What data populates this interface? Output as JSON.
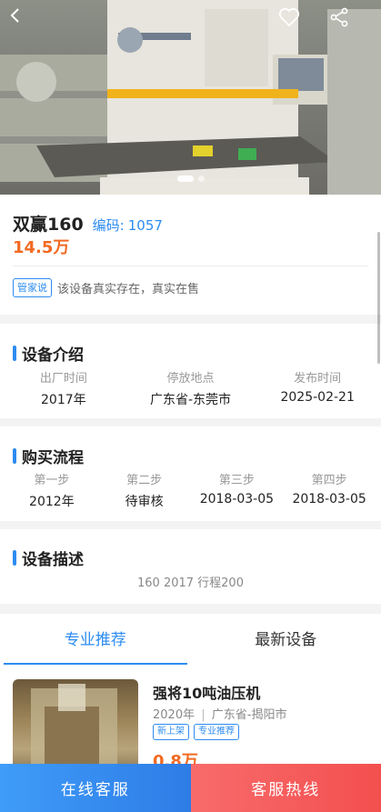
{
  "hero": {
    "back_icon": "back-arrow-icon",
    "favorite_icon": "heart-outline-icon",
    "share_icon": "share-icon",
    "slide_count": 2,
    "active_slide": 1
  },
  "product": {
    "name": "双赢160",
    "code_label": "编码:",
    "code": "1057",
    "price": "14.5万",
    "note_badge": "管家说",
    "note_text": "该设备真实存在，真实在售"
  },
  "intro": {
    "title": "设备介绍",
    "columns": [
      {
        "label": "出厂时间",
        "value": "2017年"
      },
      {
        "label": "停放地点",
        "value": "广东省-东莞市"
      },
      {
        "label": "发布时间",
        "value": "2025-02-21"
      }
    ]
  },
  "process": {
    "title": "购买流程",
    "steps": [
      {
        "label": "第一步",
        "value": "2012年"
      },
      {
        "label": "第二步",
        "value": "待审核"
      },
      {
        "label": "第三步",
        "value": "2018-03-05"
      },
      {
        "label": "第四步",
        "value": "2018-03-05"
      }
    ]
  },
  "description": {
    "title": "设备描述",
    "text": "160 2017 行程200"
  },
  "tabs": [
    {
      "label": "专业推荐",
      "active": true
    },
    {
      "label": "最新设备",
      "active": false
    }
  ],
  "listing": {
    "title": "强将10吨油压机",
    "year": "2020年",
    "separator": "|",
    "location": "广东省-揭阳市",
    "tags": [
      "新上架",
      "专业推荐"
    ],
    "price": "0.8万"
  },
  "bottom_bar": {
    "chat_label": "在线客服",
    "hotline_label": "客服热线"
  },
  "colors": {
    "accent": "#2d8cf0",
    "price": "#f26a21",
    "chat_button": "#2e7ce6",
    "hotline_button": "#f34f4f"
  }
}
